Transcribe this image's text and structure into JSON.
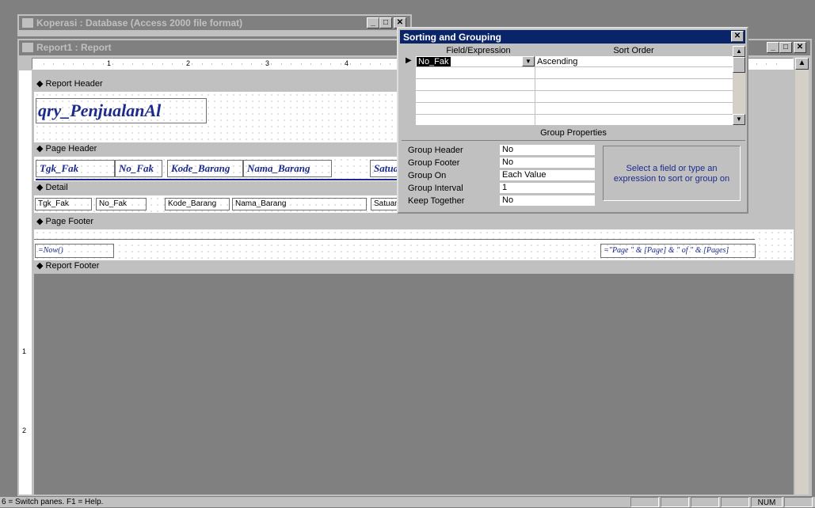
{
  "db_window": {
    "title": "Koperasi : Database (Access 2000 file format)"
  },
  "report_window": {
    "title": "Report1 : Report",
    "ruler_numbers": [
      "1",
      "2",
      "3",
      "4"
    ],
    "vruler_numbers": [
      "1",
      "2"
    ],
    "bands": {
      "report_header": "Report Header",
      "page_header": "Page Header",
      "detail": "Detail",
      "page_footer": "Page Footer",
      "report_footer": "Report Footer"
    },
    "report_title_text": "qry_PenjualanAl",
    "page_header_labels": [
      "Tgk_Fak",
      "No_Fak",
      "Kode_Barang",
      "Nama_Barang",
      "Satua"
    ],
    "detail_fields": [
      "Tgk_Fak",
      "No_Fak",
      "Kode_Barang",
      "Nama_Barang",
      "Satuan"
    ],
    "footer_now": "=Now()",
    "footer_page": "=\"Page \" & [Page] & \" of \" & [Pages]"
  },
  "sorting_dialog": {
    "title": "Sorting and Grouping",
    "columns": {
      "field": "Field/Expression",
      "order": "Sort Order"
    },
    "rows": [
      {
        "field": "No_Fak",
        "order": "Ascending"
      }
    ],
    "group_properties_title": "Group Properties",
    "properties": [
      {
        "label": "Group Header",
        "value": "No"
      },
      {
        "label": "Group Footer",
        "value": "No"
      },
      {
        "label": "Group On",
        "value": "Each Value"
      },
      {
        "label": "Group Interval",
        "value": "1"
      },
      {
        "label": "Keep Together",
        "value": "No"
      }
    ],
    "hint": "Select a field or type an expression to sort or group on"
  },
  "status_bar": {
    "text": "6 = Switch panes.  F1 = Help.",
    "num": "NUM"
  }
}
